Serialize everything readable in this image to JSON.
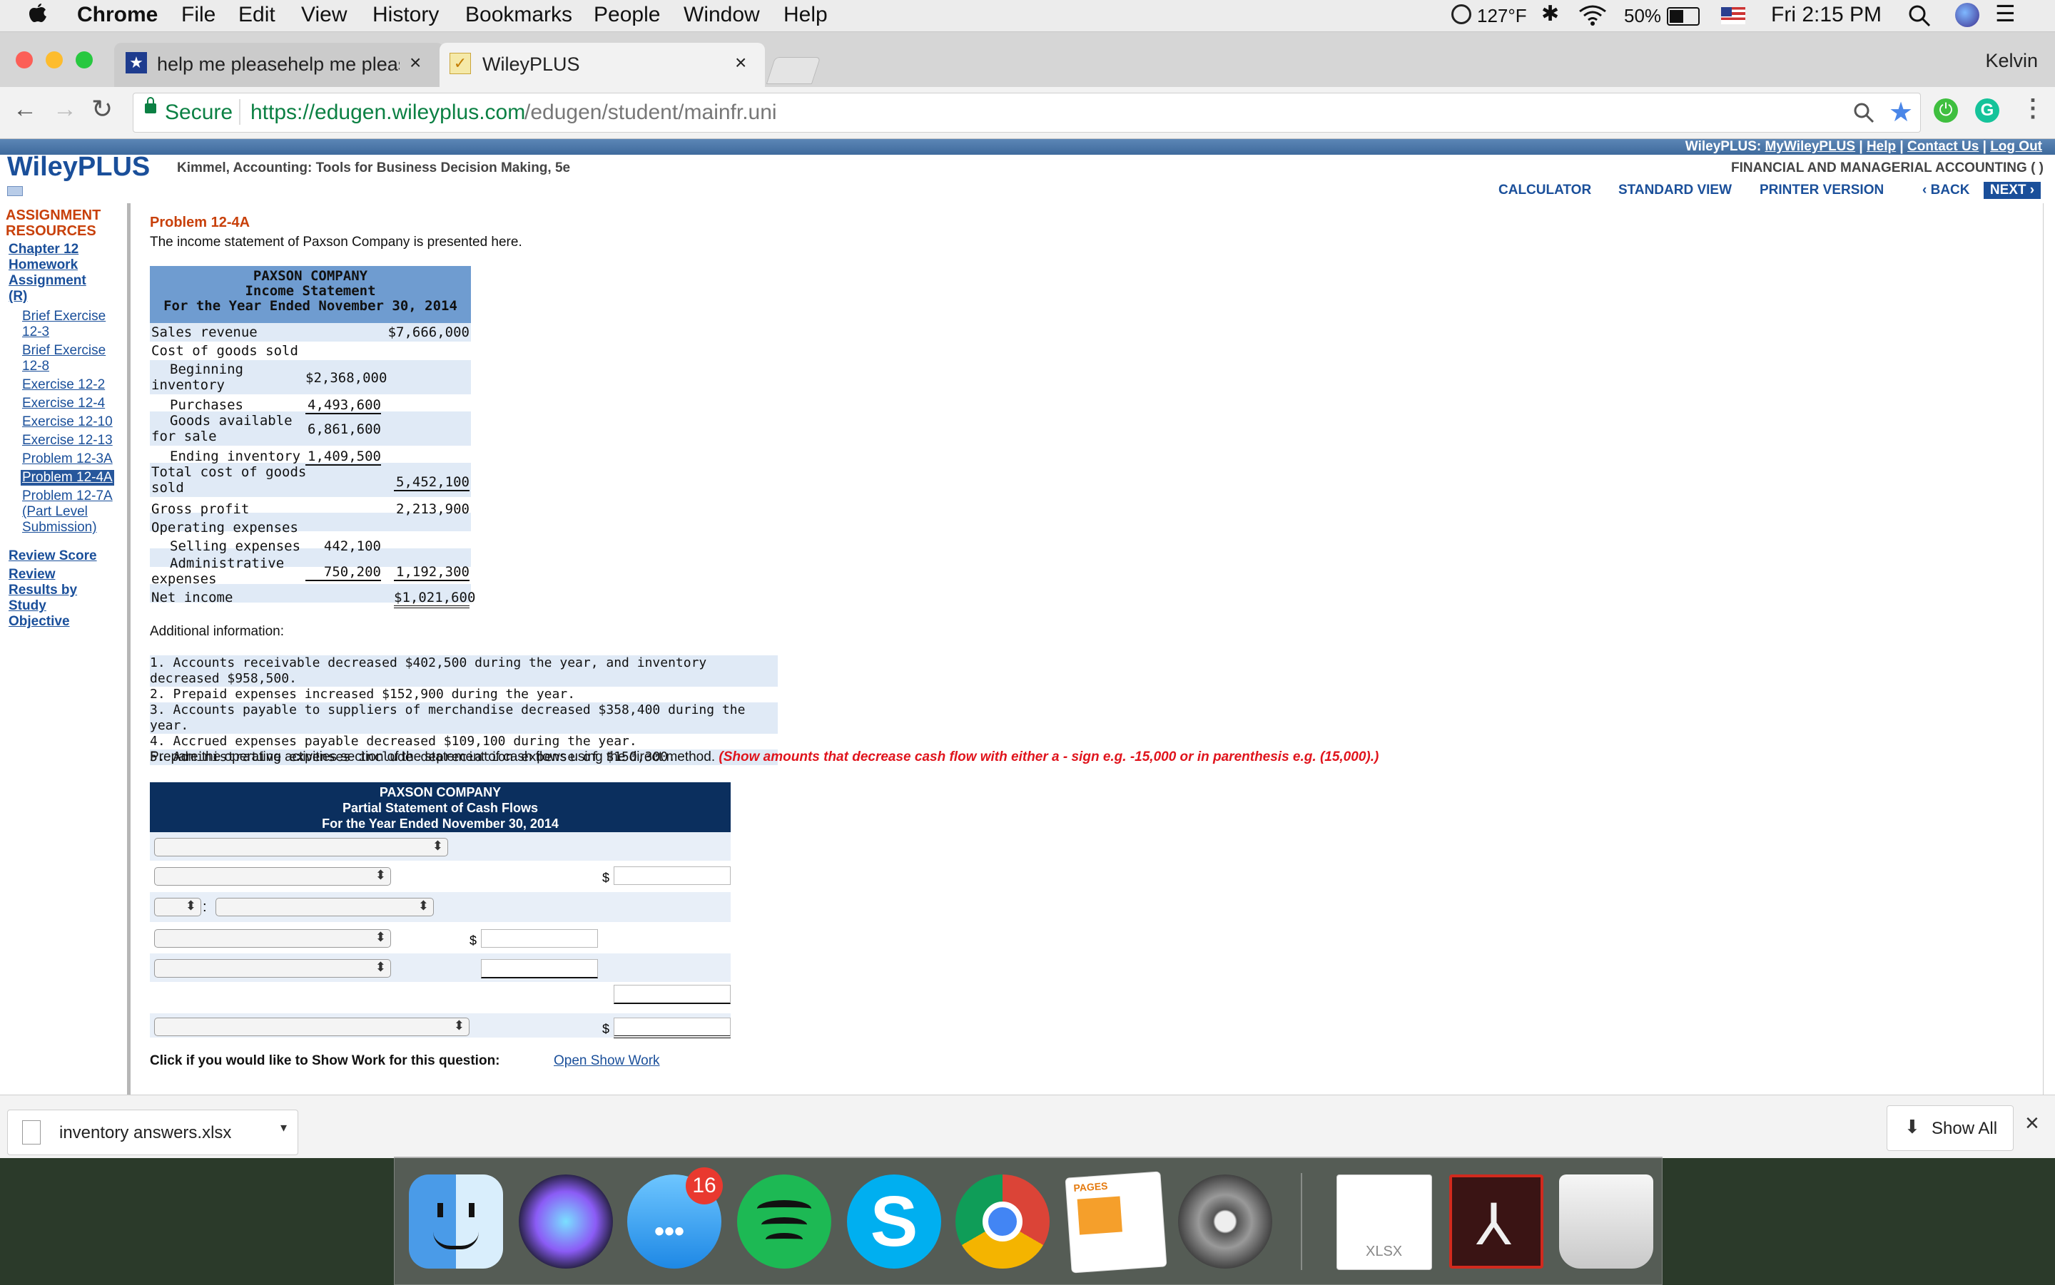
{
  "menubar": {
    "app": "Chrome",
    "items": [
      "File",
      "Edit",
      "View",
      "History",
      "Bookmarks",
      "People",
      "Window",
      "Help"
    ],
    "temp": "127°F",
    "battery": "50%",
    "time": "Fri 2:15 PM"
  },
  "browser": {
    "tabs": [
      {
        "title": "help me pleasehelp me please"
      },
      {
        "title": "WileyPLUS"
      }
    ],
    "profile": "Kelvin",
    "secure_label": "Secure",
    "url_host": "https://edugen.wileyplus.com",
    "url_path": "/edugen/student/mainfr.uni"
  },
  "wiley": {
    "logo": "WileyPLUS",
    "book": "Kimmel, Accounting: Tools for Business Decision Making, 5e",
    "top_links": {
      "prefix": "WileyPLUS:",
      "my": "MyWileyPLUS",
      "help": "Help",
      "contact": "Contact Us",
      "logout": "Log Out"
    },
    "course": "FINANCIAL AND MANAGERIAL ACCOUNTING ( )",
    "toolbar": {
      "calculator": "CALCULATOR",
      "standard_view": "STANDARD VIEW",
      "printer_version": "PRINTER VERSION",
      "back": "‹ BACK",
      "next": "NEXT ›"
    }
  },
  "sidebar": {
    "heading1": "ASSIGNMENT",
    "heading2": "RESOURCES",
    "chapter_link": [
      "Chapter 12",
      "Homework",
      "Assignment",
      "(R)"
    ],
    "items": [
      [
        "Brief Exercise",
        "12-3"
      ],
      [
        "Brief Exercise",
        "12-8"
      ],
      [
        "Exercise 12-2"
      ],
      [
        "Exercise 12-4"
      ],
      [
        "Exercise 12-10"
      ],
      [
        "Exercise 12-13"
      ],
      [
        "Problem 12-3A"
      ],
      [
        "Problem 12-4A"
      ],
      [
        "Problem 12-7A",
        "(Part Level",
        "Submission)"
      ]
    ],
    "review_score": "Review Score",
    "review_results": [
      "Review",
      "Results by",
      "Study",
      "Objective"
    ]
  },
  "problem": {
    "title": "Problem 12-4A",
    "intro": "The income statement of Paxson Company is presented here.",
    "is_header": [
      "PAXSON COMPANY",
      "Income Statement",
      "For the Year Ended November 30, 2014"
    ],
    "is_rows": {
      "sales_label": "Sales revenue",
      "sales_val": "$7,666,000",
      "cogs_label": "Cost of goods sold",
      "beg_label": [
        "Beginning",
        "inventory"
      ],
      "beg_val": "$2,368,000",
      "purch_label": "Purchases",
      "purch_val": "4,493,600",
      "gafs_label": [
        "Goods available",
        "for sale"
      ],
      "gafs_val": "6,861,600",
      "end_label": "Ending inventory",
      "end_val": "1,409,500",
      "tcogs_label": [
        "Total cost of goods",
        "sold"
      ],
      "tcogs_val": "5,452,100",
      "gp_label": "Gross profit",
      "gp_val": "2,213,900",
      "opex_label": "Operating expenses",
      "sell_label": "Selling expenses",
      "sell_val": "442,100",
      "admin_label": [
        "Administrative",
        "expenses"
      ],
      "admin_val": "750,200",
      "opex_total": "1,192,300",
      "ni_label": "Net income",
      "ni_val": "$1,021,600"
    },
    "additional_label": "Additional information:",
    "additional": [
      "1. Accounts receivable decreased $402,500 during the year, and inventory decreased $958,500.",
      "2. Prepaid expenses increased $152,900 during the year.",
      "3. Accounts payable to suppliers of merchandise decreased $358,400 during the year.",
      "4. Accrued expenses payable decreased $109,100 during the year.",
      "5. Administrative expenses include depreciation expense of $150,300."
    ],
    "instruction": "Prepare the operating activities section of the statement of cash flows using the direct method.",
    "instruction_note": "(Show amounts that decrease cash flow with either a - sign e.g. -15,000 or in parenthesis e.g. (15,000).)",
    "cf_header": [
      "PAXSON COMPANY",
      "Partial Statement of Cash Flows",
      "For the Year Ended November 30, 2014"
    ],
    "dollar": "$",
    "colon": ":",
    "show_work_label": "Click if you would like to Show Work for this question:",
    "show_work_link": "Open Show Work"
  },
  "download": {
    "file": "inventory answers.xlsx",
    "show_all": "Show All"
  },
  "dock": {
    "messages_badge": "16",
    "pages_label": "PAGES",
    "xlsx_label": "XLSX"
  },
  "colors": {
    "wiley_blue": "#1a4f9a",
    "header_blue": "#6f9cd0",
    "cf_navy": "#0b2f5e",
    "red_note": "#e0141c",
    "orange": "#c8400a"
  }
}
